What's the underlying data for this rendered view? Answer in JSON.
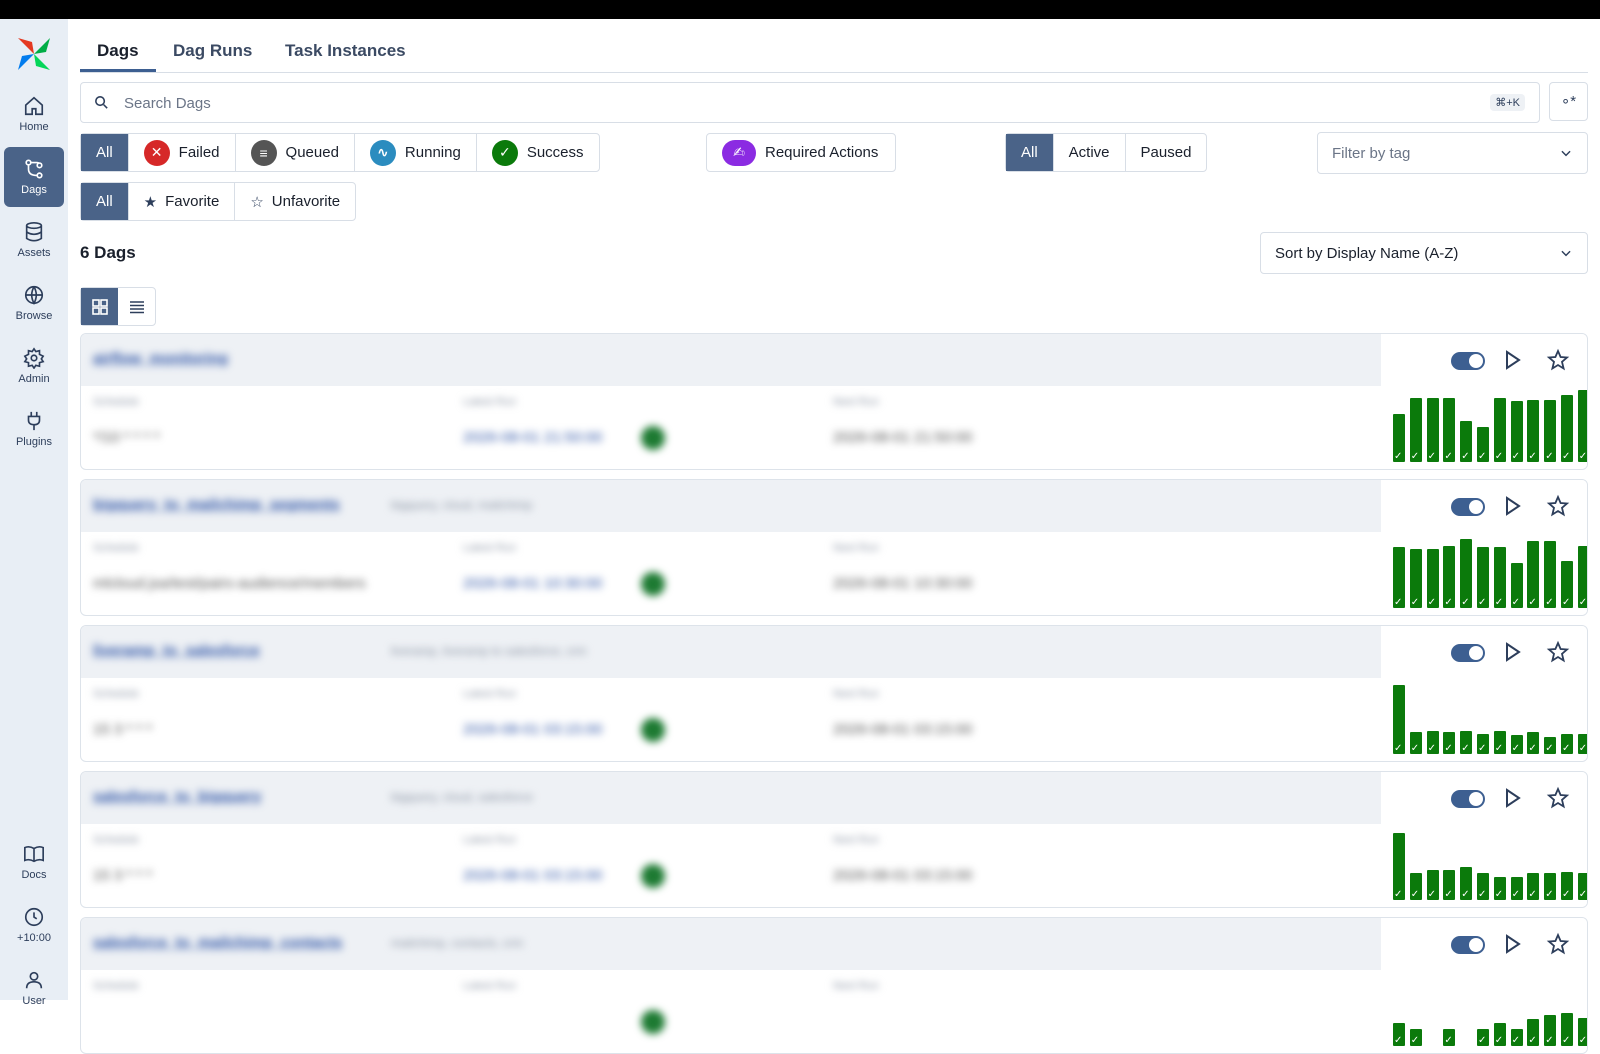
{
  "nav": [
    {
      "label": "Home",
      "icon": "home-icon"
    },
    {
      "label": "Dags",
      "icon": "dags-icon",
      "active": true
    },
    {
      "label": "Assets",
      "icon": "database-icon"
    },
    {
      "label": "Browse",
      "icon": "globe-icon"
    },
    {
      "label": "Admin",
      "icon": "gear-icon"
    },
    {
      "label": "Plugins",
      "icon": "plug-icon"
    }
  ],
  "nav_bottom": [
    {
      "label": "Docs",
      "icon": "book-icon"
    },
    {
      "label": "+10:00",
      "icon": "clock-icon"
    },
    {
      "label": "User",
      "icon": "user-icon"
    }
  ],
  "tabs": [
    "Dags",
    "Dag Runs",
    "Task Instances"
  ],
  "search": {
    "placeholder": "Search Dags",
    "shortcut": "⌘+K"
  },
  "state_filters": [
    "All",
    "Failed",
    "Queued",
    "Running",
    "Success"
  ],
  "required_actions": "Required Actions",
  "active_filters": [
    "All",
    "Active",
    "Paused"
  ],
  "tag_filter": {
    "placeholder": "Filter by tag"
  },
  "favorite_filters": [
    "All",
    "Favorite",
    "Unfavorite"
  ],
  "count_label": "6 Dags",
  "sort": {
    "label": "Sort by Display Name (A-Z)"
  },
  "colors": {
    "accent": "#4a6388",
    "success": "#0b7a0b",
    "failed": "#d62828",
    "queued": "#555555",
    "running": "#2b8cbf",
    "delete": "#a11c1c",
    "required": "#8b2be2"
  },
  "dags": [
    {
      "id": "airflow_monitoring",
      "tags": "",
      "schedule": "*/10 * * * *",
      "latest_run": "2026-08-01 21:50:00",
      "next_run": "2026-08-01 21:50:00",
      "runs": [
        0.62,
        0.82,
        0.82,
        0.82,
        0.52,
        0.45,
        0.82,
        0.78,
        0.8,
        0.8,
        0.86,
        0.92,
        0.78,
        0.35
      ]
    },
    {
      "id": "bigquery_to_mailchimp_segments",
      "tags": "bigquery, cloud, mailchimp",
      "schedule": "mlcloud.jsa/test/pairs-audience/members",
      "latest_run": "2026-08-01 10:30:00",
      "next_run": "2026-08-01 10:30:00",
      "runs": [
        0.78,
        0.76,
        0.76,
        0.8,
        0.88,
        0.78,
        0.78,
        0.58,
        0.86,
        0.86,
        0.6,
        0.8,
        0.6,
        0.78
      ]
    },
    {
      "id": "liveramp_to_salesforce",
      "tags": "liveramp, liveramp to salesforce, crm",
      "schedule": "15 3 * * *",
      "latest_run": "2026-08-01 03:15:00",
      "next_run": "2026-08-01 03:15:00",
      "runs": [
        0.88,
        0.28,
        0.3,
        0.28,
        0.3,
        0.26,
        0.3,
        0.24,
        0.28,
        0.22,
        0.26,
        0.26,
        0.26,
        0.26
      ]
    },
    {
      "id": "salesforce_to_bigquery",
      "tags": "bigquery, cloud, salesforce",
      "schedule": "15 3 * * *",
      "latest_run": "2026-08-01 03:15:00",
      "next_run": "2026-08-01 03:15:00",
      "runs": [
        0.86,
        0.34,
        0.38,
        0.38,
        0.42,
        0.34,
        0.3,
        0.3,
        0.34,
        0.34,
        0.36,
        0.34,
        0.38,
        0.38
      ]
    },
    {
      "id": "salesforce_to_mailchimp_contacts",
      "tags": "mailchimp, contacts, crm",
      "schedule": "",
      "latest_run": "",
      "next_run": "",
      "runs": [
        0.3,
        0.22,
        0.0,
        0.22,
        0.0,
        0.22,
        0.3,
        0.22,
        0.34,
        0.4,
        0.42,
        0.36,
        0.3,
        0.3
      ]
    }
  ],
  "field_labels": {
    "schedule": "Schedule",
    "latest_run": "Latest Run",
    "next_run": "Next Run"
  }
}
